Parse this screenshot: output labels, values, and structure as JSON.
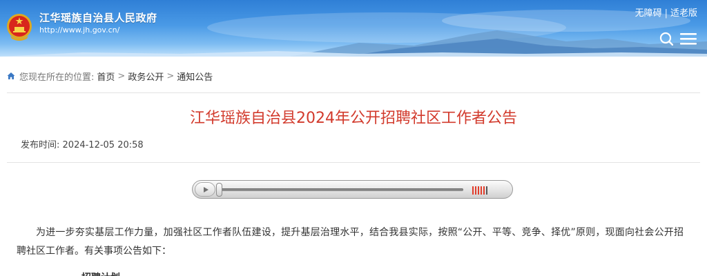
{
  "header": {
    "site_title": "江华瑶族自治县人民政府",
    "site_url": "http://www.jh.gov.cn/",
    "accessibility_link": "无障碍",
    "separator": "|",
    "elder_mode_link": "适老版",
    "icons": [
      "national-emblem-icon",
      "search-icon",
      "menu-icon"
    ]
  },
  "breadcrumb": {
    "prefix": "您现在所在的位置:",
    "items": [
      "首页",
      "政务公开",
      "通知公告"
    ],
    "arrow": ">"
  },
  "article": {
    "title": "江华瑶族自治县2024年公开招聘社区工作者公告",
    "publish_label": "发布时间:",
    "publish_time": "2024-12-05 20:58",
    "paragraph_1": "为进一步夯实基层工作力量，加强社区工作者队伍建设，提升基层治理水平，结合我县实际，按照“公开、平等、竞争、择优”原则，现面向社会公开招聘社区工作者。有关事项公告如下：",
    "section_heading_1": "一、招聘计划"
  },
  "audio_player": {
    "progress": 0,
    "volume_level": 0.83
  },
  "colors": {
    "title_red": "#d23a2c",
    "banner_blue": "#3b8ee0",
    "volume_red": "#e23c2a"
  }
}
